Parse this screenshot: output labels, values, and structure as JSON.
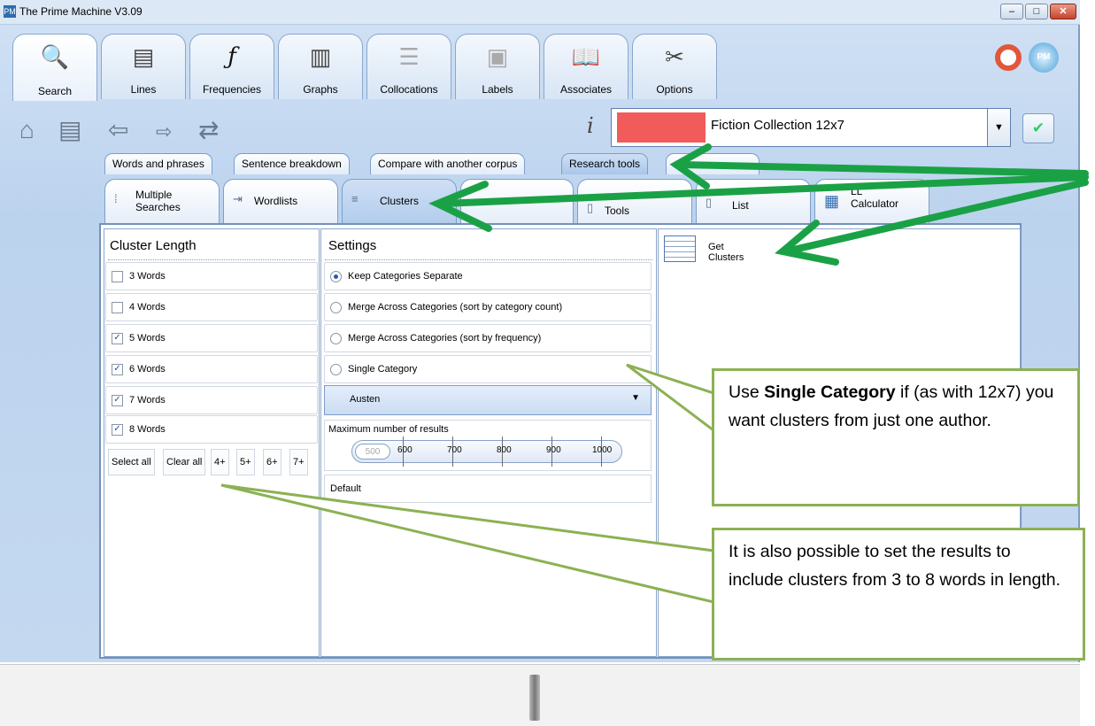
{
  "window": {
    "title": "The Prime Machine V3.09",
    "app_icon": "PM",
    "minimize": "–",
    "maximize": "□",
    "close": "✕"
  },
  "ribbon": {
    "tabs": [
      {
        "label": "Search",
        "icon": "search-icon",
        "glyph": "🔍"
      },
      {
        "label": "Lines",
        "icon": "lines-icon",
        "glyph": "▤"
      },
      {
        "label": "Frequencies",
        "icon": "function-icon",
        "glyph": "ƒ"
      },
      {
        "label": "Graphs",
        "icon": "bar-chart-icon",
        "glyph": "▥"
      },
      {
        "label": "Collocations",
        "icon": "collocations-icon",
        "glyph": "☰"
      },
      {
        "label": "Labels",
        "icon": "labels-icon",
        "glyph": "▣"
      },
      {
        "label": "Associates",
        "icon": "associates-icon",
        "glyph": "📖"
      },
      {
        "label": "Options",
        "icon": "tools-icon",
        "glyph": "✂"
      }
    ],
    "help_glyph": "⊕",
    "globe_label": "PM"
  },
  "toolbar": {
    "home_glyph": "⌂",
    "list_glyph": "▤",
    "back_glyph": "⇦",
    "forward_glyph": "⇨",
    "swap_glyph": "⇄",
    "info_glyph": "i",
    "corpus_name": "Fiction Collection 12x7",
    "corpus_color": "#f25b5b",
    "dropdown_glyph": "▼",
    "go_glyph": "✔"
  },
  "subtabs": [
    "Words and phrases",
    "Sentence breakdown",
    "Compare with another corpus",
    "Research tools"
  ],
  "tooltabs": [
    {
      "label": "Multiple\nSearches",
      "glyph": "⁞"
    },
    {
      "label": "Wordlists",
      "glyph": "⇥"
    },
    {
      "label": "Clusters",
      "glyph": "≡"
    },
    {
      "label": "",
      "glyph": ""
    },
    {
      "label": "Tools",
      "glyph": "▯"
    },
    {
      "label": "List",
      "glyph": "▯"
    },
    {
      "label": "LL\nCalculator",
      "glyph": "▦"
    }
  ],
  "cluster_length": {
    "heading": "Cluster Length",
    "options": [
      {
        "label": "3 Words",
        "checked": false
      },
      {
        "label": "4 Words",
        "checked": false
      },
      {
        "label": "5 Words",
        "checked": true
      },
      {
        "label": "6 Words",
        "checked": true
      },
      {
        "label": "7 Words",
        "checked": true
      },
      {
        "label": "8 Words",
        "checked": true
      }
    ],
    "buttons": [
      "Select all",
      "Clear all",
      "4+",
      "5+",
      "6+",
      "7+"
    ]
  },
  "settings": {
    "heading": "Settings",
    "options": [
      {
        "label": "Keep Categories Separate",
        "selected": true
      },
      {
        "label": "Merge Across Categories (sort by category count)",
        "selected": false
      },
      {
        "label": "Merge Across Categories (sort by frequency)",
        "selected": false
      },
      {
        "label": "Single Category",
        "selected": false
      }
    ],
    "category_value": "Austen",
    "max_results_label": "Maximum number of results",
    "max_results_value": "500",
    "slider_ticks": [
      "600",
      "700",
      "800",
      "900",
      "1000"
    ],
    "default_label": "Default"
  },
  "actions": {
    "get_clusters": "Get Clusters"
  },
  "callouts": {
    "c1_pre": "Use ",
    "c1_bold": "Single Category",
    "c1_post": " if (as with 12x7) you want clusters from just one author.",
    "c2": "It is also possible to set the results to include clusters from 3 to 8 words in length."
  }
}
